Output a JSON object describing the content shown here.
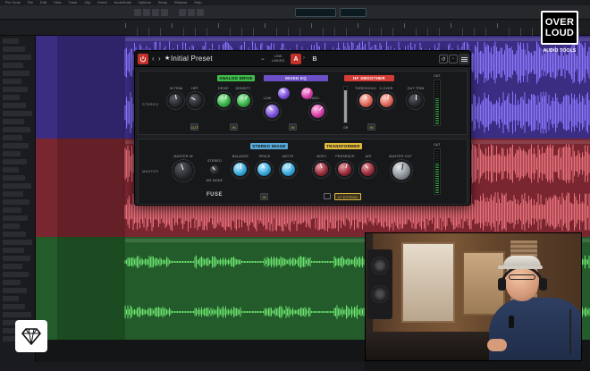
{
  "daw": {
    "menu": [
      "Pro Tools",
      "File",
      "Edit",
      "View",
      "Track",
      "Clip",
      "Event",
      "AudioSuite",
      "Options",
      "Setup",
      "Window",
      "Help"
    ],
    "lane_colors": {
      "purple": "#3a2d82",
      "red": "#7a2630",
      "green": "#235c2a"
    },
    "wave_colors": {
      "purple": "#8a77ff",
      "red": "#e8727c",
      "green": "#6be26f"
    }
  },
  "plugin": {
    "preset_name": "Initial Preset",
    "link_label": "LINK",
    "linked_label": "LINKED",
    "ab": {
      "a": "A",
      "b": "B"
    },
    "product": "FUSE",
    "upper": {
      "side_label": "STEREO",
      "section_tags": {
        "analog_drive": "ANALOG DRIVE",
        "mixed_eq": "MIXED EQ",
        "hf_smoother": "HF SMOOTHER"
      },
      "knobs": {
        "in_trim": "IN TRIM",
        "hpf": "HPF",
        "drive": "DRIVE",
        "density": "DENSITY",
        "low": "LOW",
        "high": "HIGH",
        "threshold": "THRESHOLD",
        "x_over": "X-OVER",
        "out_trim": "OUT TRIM"
      },
      "buttons": {
        "cut": "CUT",
        "in": "IN"
      },
      "meter_labels": {
        "gr": "GR",
        "out": "OUT"
      }
    },
    "lower": {
      "side_label": "MASTER",
      "section_tags": {
        "stereo_image": "STEREO IMAGE",
        "transformer": "TRANSFORMER"
      },
      "knobs": {
        "master_in": "MASTER IN",
        "stereo_mode": "STEREO",
        "balance": "BALANCE",
        "space": "SPACE",
        "width": "WIDTH",
        "body": "BODY",
        "presence": "PRESENCE",
        "air": "AIR",
        "master_out": "MASTER OUT"
      },
      "stereo_submode": "MS MODE",
      "buttons": {
        "in": "IN",
        "lf_extend": "LF EXTEND"
      },
      "meter_labels": {
        "out": "OUT"
      }
    }
  },
  "branding": {
    "logo_line1": "OVER",
    "logo_line2": "LOUD",
    "logo_tagline": "AUDIO TOOLS"
  }
}
